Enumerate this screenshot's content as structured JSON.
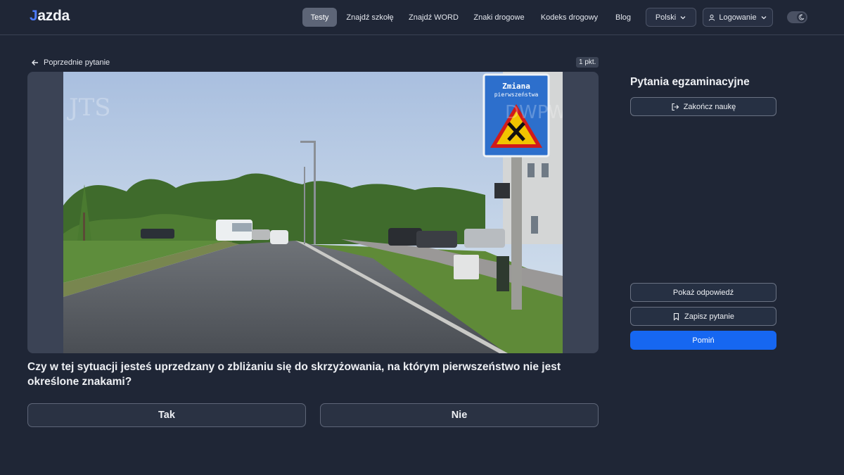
{
  "header": {
    "logo": {
      "mark": "J",
      "text": "azda"
    },
    "nav": [
      "Testy",
      "Znajdź szkołę",
      "Znajdź WORD",
      "Znaki drogowe",
      "Kodeks drogowy",
      "Blog"
    ],
    "active_nav": "Testy",
    "language": "Polski",
    "login": "Logowanie",
    "theme_toggle_icon": "moon-icon"
  },
  "question_card": {
    "back_label": "Poprzednie pytanie",
    "points": "1 pkt.",
    "image": {
      "sign_text": [
        "Zmiana",
        "pierwszeństwa"
      ],
      "watermark_left": "JTS",
      "watermark_right": "DWPW"
    },
    "question": "Czy w tej sytuacji jesteś uprzedzany o zbliżaniu się do skrzyżowania, na którym pierwszeństwo nie jest określone znakami?",
    "answers": [
      "Tak",
      "Nie"
    ]
  },
  "sidebar": {
    "title": "Pytania egzaminacyjne",
    "end_learning": "Zakończ naukę",
    "show_answer": "Pokaż odpowiedź",
    "save_question": "Zapisz pytanie",
    "skip": "Pomiń"
  },
  "colors": {
    "background": "#1f2636",
    "accent": "#1667f1",
    "logo_accent": "#4d7cff"
  }
}
